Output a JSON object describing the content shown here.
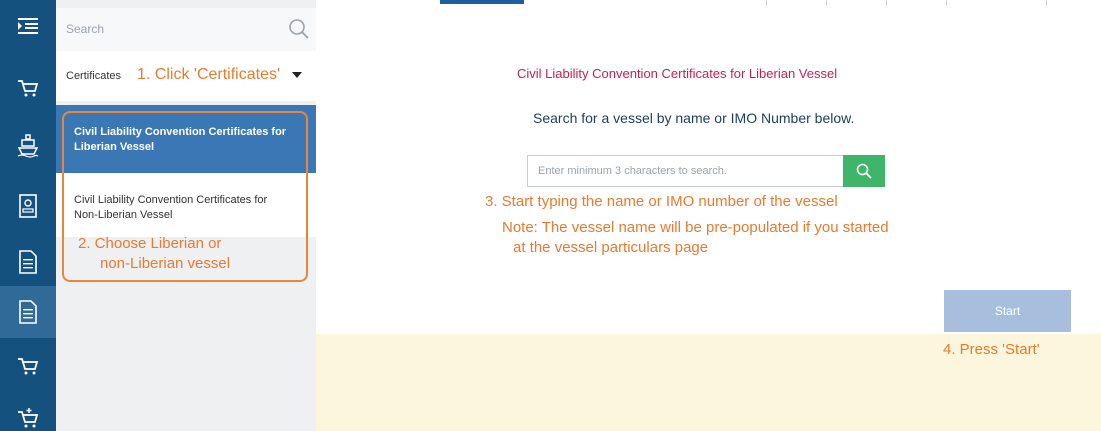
{
  "rail": {
    "items": [
      {
        "icon": "menu-icon"
      },
      {
        "icon": "cart-icon"
      },
      {
        "icon": "ship-icon"
      },
      {
        "icon": "id-card-icon"
      },
      {
        "icon": "document-icon"
      },
      {
        "icon": "document-icon",
        "active": true
      },
      {
        "icon": "cart-icon"
      },
      {
        "icon": "cart-plus-icon"
      }
    ]
  },
  "panel": {
    "search_placeholder": "Search",
    "section_label": "Certificates",
    "items": [
      {
        "label": "Civil Liability Convention Certificates for Liberian Vessel",
        "selected": true
      },
      {
        "label": "Civil Liability Convention Certificates for Non-Liberian Vessel",
        "selected": false
      }
    ]
  },
  "main": {
    "title": "Civil Liability Convention Certificates for Liberian Vessel",
    "subtitle": "Search for a vessel by name or IMO Number below.",
    "vessel_search_placeholder": "Enter minimum 3 characters to search.",
    "start_label": "Start"
  },
  "annotations": {
    "step1": "1. Click 'Certificates'",
    "step2_line1": "2. Choose Liberian or",
    "step2_line2": "non-Liberian vessel",
    "step3": "3. Start typing the name or IMO number of the vessel",
    "note_line1": "Note: The vessel name will be pre-populated if you started",
    "note_line2": "at the vessel particulars page",
    "step4": "4. Press 'Start'"
  },
  "colors": {
    "rail": "#14517f",
    "selected_item": "#3c77b5",
    "title": "#c71f54",
    "annotation": "#e97a2f",
    "search_button": "#3fb56a",
    "start_button": "#a7bfdc"
  }
}
